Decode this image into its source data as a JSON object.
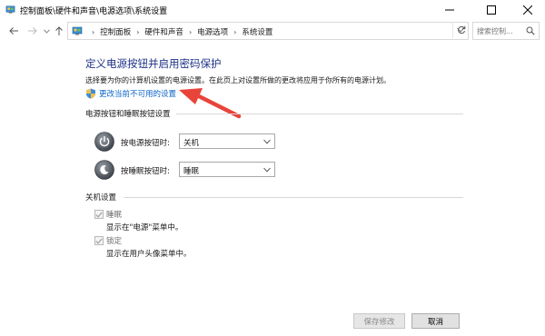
{
  "window": {
    "title": "控制面板\\硬件和声音\\电源选项\\系统设置"
  },
  "address": {
    "breadcrumbs": [
      "控制面板",
      "硬件和声音",
      "电源选项",
      "系统设置"
    ],
    "search_placeholder": "搜索控制..."
  },
  "main": {
    "heading": "定义电源按钮并启用密码保护",
    "description": "选择要为你的计算机设置的电源设置。在此页上对设置所做的更改将应用于你所有的电源计划。",
    "change_link": "更改当前不可用的设置",
    "power_section": {
      "title": "电源按钮和睡眠按钮设置",
      "rows": [
        {
          "label": "按电源按钮时:",
          "value": "关机"
        },
        {
          "label": "按睡眠按钮时:",
          "value": "睡眠"
        }
      ]
    },
    "shutdown_section": {
      "title": "关机设置",
      "items": [
        {
          "label": "睡眠",
          "description": "显示在\"电源\"菜单中。",
          "checked": true
        },
        {
          "label": "锁定",
          "description": "显示在用户头像菜单中。",
          "checked": true
        }
      ]
    }
  },
  "footer": {
    "save_label": "保存修改",
    "cancel_label": "取消"
  },
  "colors": {
    "heading": "#1e3287",
    "link": "#0a64c8",
    "annotation_arrow": "#e8443a"
  }
}
